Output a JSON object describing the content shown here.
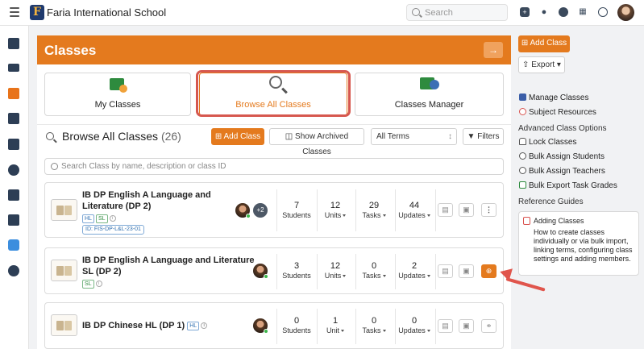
{
  "topbar": {
    "school_name": "Faria International School",
    "logo_letter": "F",
    "search_placeholder": "Search"
  },
  "banner": {
    "title": "Classes",
    "arrow": "→"
  },
  "tabs": [
    {
      "label": "My Classes"
    },
    {
      "label": "Browse All Classes"
    },
    {
      "label": "Classes Manager"
    }
  ],
  "browse": {
    "title": "Browse All Classes",
    "count": "(26)",
    "add_class": "Add Class",
    "show_archived": "Show Archived Classes",
    "terms": "All Terms",
    "filters": "Filters",
    "search_placeholder": "Search Class by name, description or class ID"
  },
  "classes": [
    {
      "name_line1": "IB DP English A Language and",
      "name_line2": "Literature (DP 2)",
      "tags": [
        "HL",
        "SL"
      ],
      "class_id": "ID: FIS-DP-L&L-23-01",
      "extra_teachers": "+2",
      "students": "7",
      "students_label": "Students",
      "units": "12",
      "units_label": "Units",
      "tasks": "29",
      "tasks_label": "Tasks",
      "updates": "44",
      "updates_label": "Updates"
    },
    {
      "name_line1": "IB DP English A Language and Literature",
      "name_line2": "SL (DP 2)",
      "tags": [
        "SL"
      ],
      "students": "3",
      "students_label": "Students",
      "units": "12",
      "units_label": "Units",
      "tasks": "0",
      "tasks_label": "Tasks",
      "updates": "2",
      "updates_label": "Updates"
    },
    {
      "name_line1": "IB DP Chinese HL (DP 1)",
      "tags": [
        "HL"
      ],
      "students": "0",
      "students_label": "Students",
      "units": "1",
      "units_label": "Unit",
      "tasks": "0",
      "tasks_label": "Tasks",
      "updates": "0",
      "updates_label": "Updates"
    }
  ],
  "sidebar": {
    "add_class": "Add Class",
    "export": "Export",
    "links": [
      {
        "label": "Manage Classes",
        "icon": "manage-icon"
      },
      {
        "label": "Subject Resources",
        "icon": "resources-icon"
      }
    ],
    "advanced_heading": "Advanced Class Options",
    "advanced": [
      {
        "label": "Lock Classes",
        "icon": "lock-icon"
      },
      {
        "label": "Bulk Assign Students",
        "icon": "students-icon"
      },
      {
        "label": "Bulk Assign Teachers",
        "icon": "teachers-icon"
      },
      {
        "label": "Bulk Export Task Grades",
        "icon": "export-grades-icon"
      }
    ],
    "reference_heading": "Reference Guides",
    "guide_title": "Adding Classes",
    "guide_text": "How to create classes individually or via bulk import, linking terms, configuring class settings and adding members."
  },
  "colors": {
    "accent": "#e47a1e",
    "highlight": "#d6584f",
    "nav_dark": "#2d3e55"
  }
}
